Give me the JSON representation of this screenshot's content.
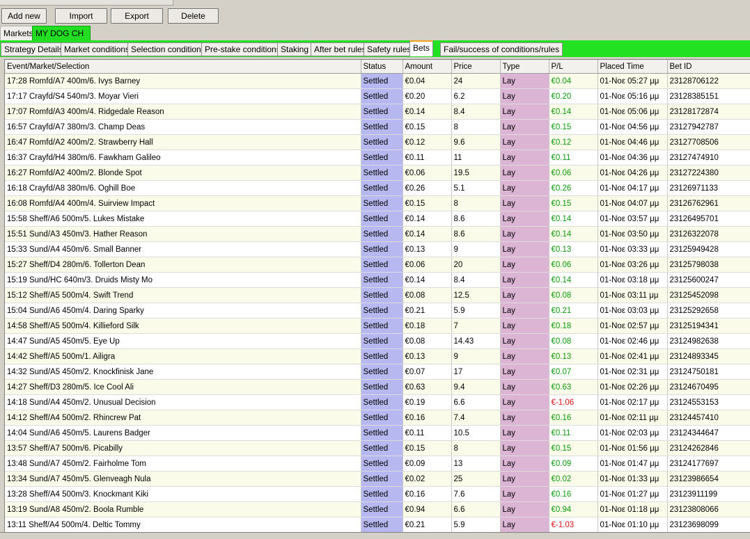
{
  "toolbar": {
    "buttons": [
      {
        "label": "Add new"
      },
      {
        "label": "Import"
      },
      {
        "label": "Export"
      },
      {
        "label": "Delete"
      }
    ]
  },
  "market_tabs": [
    {
      "label": "Markets"
    },
    {
      "label": "MY DOG CH"
    }
  ],
  "strategy_tabs": [
    {
      "label": "Strategy Details"
    },
    {
      "label": "Market conditions"
    },
    {
      "label": "Selection conditions"
    },
    {
      "label": "Pre-stake conditions"
    },
    {
      "label": "Staking"
    },
    {
      "label": "After bet rules"
    },
    {
      "label": "Safety rules"
    },
    {
      "label": "Bets"
    },
    {
      "label": "Fail/success of conditions/rules"
    }
  ],
  "active_strategy_tab": "Bets",
  "colors": {
    "green_bar": "#22e022",
    "status_column": "#b8b8f0",
    "type_column": "#dcb4d4",
    "profit": "#0a9a0a",
    "loss": "#e01010"
  },
  "grid": {
    "columns": [
      "Event/Market/Selection",
      "Status",
      "Amount",
      "Price",
      "Type",
      "P/L",
      "Placed Time",
      "Bet ID"
    ],
    "rows": [
      {
        "event": "17:28 Romfd/A7 400m/6. Ivys Barney",
        "status": "Settled",
        "amount": "€0.04",
        "price": "24",
        "type": "Lay",
        "pl": "€0.04",
        "time": "01-Νοε 05:27 μμ",
        "bet_id": "23128706122"
      },
      {
        "event": "17:17 Crayfd/S4 540m/3. Moyar Vieri",
        "status": "Settled",
        "amount": "€0.20",
        "price": "6.2",
        "type": "Lay",
        "pl": "€0.20",
        "time": "01-Νοε 05:16 μμ",
        "bet_id": "23128385151"
      },
      {
        "event": "17:07 Romfd/A3 400m/4. Ridgedale Reason",
        "status": "Settled",
        "amount": "€0.14",
        "price": "8.4",
        "type": "Lay",
        "pl": "€0.14",
        "time": "01-Νοε 05:06 μμ",
        "bet_id": "23128172874"
      },
      {
        "event": "16:57 Crayfd/A7 380m/3. Champ Deas",
        "status": "Settled",
        "amount": "€0.15",
        "price": "8",
        "type": "Lay",
        "pl": "€0.15",
        "time": "01-Νοε 04:56 μμ",
        "bet_id": "23127942787"
      },
      {
        "event": "16:47 Romfd/A2 400m/2. Strawberry Hall",
        "status": "Settled",
        "amount": "€0.12",
        "price": "9.6",
        "type": "Lay",
        "pl": "€0.12",
        "time": "01-Νοε 04:46 μμ",
        "bet_id": "23127708506"
      },
      {
        "event": "16:37 Crayfd/H4 380m/6. Fawkham Galileo",
        "status": "Settled",
        "amount": "€0.11",
        "price": "11",
        "type": "Lay",
        "pl": "€0.11",
        "time": "01-Νοε 04:36 μμ",
        "bet_id": "23127474910"
      },
      {
        "event": "16:27 Romfd/A2 400m/2. Blonde Spot",
        "status": "Settled",
        "amount": "€0.06",
        "price": "19.5",
        "type": "Lay",
        "pl": "€0.06",
        "time": "01-Νοε 04:26 μμ",
        "bet_id": "23127224380"
      },
      {
        "event": "16:18 Crayfd/A8 380m/6. Oghill Boe",
        "status": "Settled",
        "amount": "€0.26",
        "price": "5.1",
        "type": "Lay",
        "pl": "€0.26",
        "time": "01-Νοε 04:17 μμ",
        "bet_id": "23126971133"
      },
      {
        "event": "16:08 Romfd/A4 400m/4. Suirview Impact",
        "status": "Settled",
        "amount": "€0.15",
        "price": "8",
        "type": "Lay",
        "pl": "€0.15",
        "time": "01-Νοε 04:07 μμ",
        "bet_id": "23126762961"
      },
      {
        "event": "15:58 Sheff/A6 500m/5. Lukes Mistake",
        "status": "Settled",
        "amount": "€0.14",
        "price": "8.6",
        "type": "Lay",
        "pl": "€0.14",
        "time": "01-Νοε 03:57 μμ",
        "bet_id": "23126495701"
      },
      {
        "event": "15:51 Sund/A3 450m/3. Hather Reason",
        "status": "Settled",
        "amount": "€0.14",
        "price": "8.6",
        "type": "Lay",
        "pl": "€0.14",
        "time": "01-Νοε 03:50 μμ",
        "bet_id": "23126322078"
      },
      {
        "event": "15:33 Sund/A4 450m/6. Small Banner",
        "status": "Settled",
        "amount": "€0.13",
        "price": "9",
        "type": "Lay",
        "pl": "€0.13",
        "time": "01-Νοε 03:33 μμ",
        "bet_id": "23125949428"
      },
      {
        "event": "15:27 Sheff/D4 280m/6. Tollerton Dean",
        "status": "Settled",
        "amount": "€0.06",
        "price": "20",
        "type": "Lay",
        "pl": "€0.06",
        "time": "01-Νοε 03:26 μμ",
        "bet_id": "23125798038"
      },
      {
        "event": "15:19 Sund/HC 640m/3. Druids Misty Mo",
        "status": "Settled",
        "amount": "€0.14",
        "price": "8.4",
        "type": "Lay",
        "pl": "€0.14",
        "time": "01-Νοε 03:18 μμ",
        "bet_id": "23125600247"
      },
      {
        "event": "15:12 Sheff/A5 500m/4. Swift Trend",
        "status": "Settled",
        "amount": "€0.08",
        "price": "12.5",
        "type": "Lay",
        "pl": "€0.08",
        "time": "01-Νοε 03:11 μμ",
        "bet_id": "23125452098"
      },
      {
        "event": "15:04 Sund/A6 450m/4. Daring Sparky",
        "status": "Settled",
        "amount": "€0.21",
        "price": "5.9",
        "type": "Lay",
        "pl": "€0.21",
        "time": "01-Νοε 03:03 μμ",
        "bet_id": "23125292658"
      },
      {
        "event": "14:58 Sheff/A5 500m/4. Killieford Silk",
        "status": "Settled",
        "amount": "€0.18",
        "price": "7",
        "type": "Lay",
        "pl": "€0.18",
        "time": "01-Νοε 02:57 μμ",
        "bet_id": "23125194341"
      },
      {
        "event": "14:47 Sund/A5 450m/5. Eye Up",
        "status": "Settled",
        "amount": "€0.08",
        "price": "14.43",
        "type": "Lay",
        "pl": "€0.08",
        "time": "01-Νοε 02:46 μμ",
        "bet_id": "23124982638"
      },
      {
        "event": "14:42 Sheff/A5 500m/1. Ailigra",
        "status": "Settled",
        "amount": "€0.13",
        "price": "9",
        "type": "Lay",
        "pl": "€0.13",
        "time": "01-Νοε 02:41 μμ",
        "bet_id": "23124893345"
      },
      {
        "event": "14:32 Sund/A5 450m/2. Knockfinisk Jane",
        "status": "Settled",
        "amount": "€0.07",
        "price": "17",
        "type": "Lay",
        "pl": "€0.07",
        "time": "01-Νοε 02:31 μμ",
        "bet_id": "23124750181"
      },
      {
        "event": "14:27 Sheff/D3 280m/5. Ice Cool Ali",
        "status": "Settled",
        "amount": "€0.63",
        "price": "9.4",
        "type": "Lay",
        "pl": "€0.63",
        "time": "01-Νοε 02:26 μμ",
        "bet_id": "23124670495"
      },
      {
        "event": "14:18 Sund/A4 450m/2. Unusual Decision",
        "status": "Settled",
        "amount": "€0.19",
        "price": "6.6",
        "type": "Lay",
        "pl": "€-1.06",
        "time": "01-Νοε 02:17 μμ",
        "bet_id": "23124553153"
      },
      {
        "event": "14:12 Sheff/A4 500m/2. Rhincrew Pat",
        "status": "Settled",
        "amount": "€0.16",
        "price": "7.4",
        "type": "Lay",
        "pl": "€0.16",
        "time": "01-Νοε 02:11 μμ",
        "bet_id": "23124457410"
      },
      {
        "event": "14:04 Sund/A6 450m/5. Laurens Badger",
        "status": "Settled",
        "amount": "€0.11",
        "price": "10.5",
        "type": "Lay",
        "pl": "€0.11",
        "time": "01-Νοε 02:03 μμ",
        "bet_id": "23124344647"
      },
      {
        "event": "13:57 Sheff/A7 500m/6. Picabilly",
        "status": "Settled",
        "amount": "€0.15",
        "price": "8",
        "type": "Lay",
        "pl": "€0.15",
        "time": "01-Νοε 01:56 μμ",
        "bet_id": "23124262846"
      },
      {
        "event": "13:48 Sund/A7 450m/2. Fairholme Tom",
        "status": "Settled",
        "amount": "€0.09",
        "price": "13",
        "type": "Lay",
        "pl": "€0.09",
        "time": "01-Νοε 01:47 μμ",
        "bet_id": "23124177697"
      },
      {
        "event": "13:34 Sund/A7 450m/5. Glenveagh Nula",
        "status": "Settled",
        "amount": "€0.02",
        "price": "25",
        "type": "Lay",
        "pl": "€0.02",
        "time": "01-Νοε 01:33 μμ",
        "bet_id": "23123986654"
      },
      {
        "event": "13:28 Sheff/A4 500m/3. Knockmant Kiki",
        "status": "Settled",
        "amount": "€0.16",
        "price": "7.6",
        "type": "Lay",
        "pl": "€0.16",
        "time": "01-Νοε 01:27 μμ",
        "bet_id": "23123911199"
      },
      {
        "event": "13:19 Sund/A8 450m/2. Boola Rumble",
        "status": "Settled",
        "amount": "€0.94",
        "price": "6.6",
        "type": "Lay",
        "pl": "€0.94",
        "time": "01-Νοε 01:18 μμ",
        "bet_id": "23123808066"
      },
      {
        "event": "13:11 Sheff/A4 500m/4. Deltic Tommy",
        "status": "Settled",
        "amount": "€0.21",
        "price": "5.9",
        "type": "Lay",
        "pl": "€-1.03",
        "time": "01-Νοε 01:10 μμ",
        "bet_id": "23123698099"
      }
    ]
  }
}
